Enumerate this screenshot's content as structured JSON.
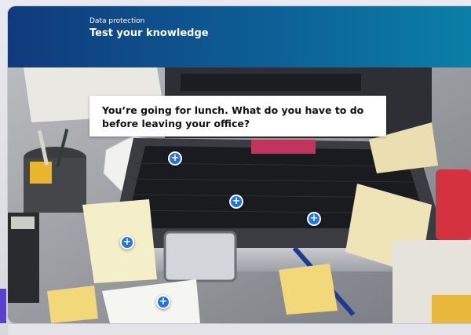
{
  "header": {
    "eyebrow": "Data protection",
    "title": "Test your knowledge"
  },
  "question": {
    "text": "You’re going for lunch. What do you have to do before leaving your office?"
  },
  "hotspots": [
    {
      "name": "hotspot-paper-ball",
      "symbol": "+"
    },
    {
      "name": "hotspot-keyboard",
      "symbol": "+"
    },
    {
      "name": "hotspot-laptop-right",
      "symbol": "+"
    },
    {
      "name": "hotspot-sticky-note",
      "symbol": "+"
    },
    {
      "name": "hotspot-documents",
      "symbol": "+"
    }
  ],
  "colors": {
    "header_start": "#103a7c",
    "header_end": "#0a7fa6",
    "hotspot": "#1f73e8",
    "accent": "#5b3fd0"
  }
}
